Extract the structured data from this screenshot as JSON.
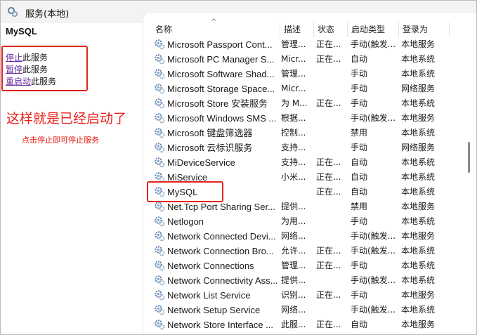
{
  "window": {
    "title": "服务(本地)",
    "icon": "gear-services-icon"
  },
  "left_panel": {
    "service_name": "MySQL",
    "actions": [
      {
        "link": "停止",
        "suffix": "此服务"
      },
      {
        "link": "暂停",
        "suffix": "此服务"
      },
      {
        "link": "重启动",
        "suffix": "此服务"
      }
    ],
    "annotation_main": "这样就是已经启动了",
    "annotation_sub": "点击停止即可停止服务"
  },
  "table": {
    "columns": [
      "名称",
      "描述",
      "状态",
      "启动类型",
      "登录为"
    ],
    "sorted_column": "名称",
    "rows": [
      {
        "name": "Microsoft Passport Cont...",
        "desc": "管理...",
        "status": "正在...",
        "startup": "手动(触发...",
        "logon": "本地服务"
      },
      {
        "name": "Microsoft PC Manager S...",
        "desc": "Micr...",
        "status": "正在...",
        "startup": "自动",
        "logon": "本地系统"
      },
      {
        "name": "Microsoft Software Shad...",
        "desc": "管理...",
        "status": "",
        "startup": "手动",
        "logon": "本地系统"
      },
      {
        "name": "Microsoft Storage Space...",
        "desc": "Micr...",
        "status": "",
        "startup": "手动",
        "logon": "网络服务"
      },
      {
        "name": "Microsoft Store 安装服务",
        "desc": "为 M...",
        "status": "正在...",
        "startup": "手动",
        "logon": "本地系统"
      },
      {
        "name": "Microsoft Windows SMS ...",
        "desc": "根据...",
        "status": "",
        "startup": "手动(触发...",
        "logon": "本地服务"
      },
      {
        "name": "Microsoft 键盘筛选器",
        "desc": "控制...",
        "status": "",
        "startup": "禁用",
        "logon": "本地系统"
      },
      {
        "name": "Microsoft 云标识服务",
        "desc": "支持...",
        "status": "",
        "startup": "手动",
        "logon": "网络服务"
      },
      {
        "name": "MiDeviceService",
        "desc": "支持...",
        "status": "正在...",
        "startup": "自动",
        "logon": "本地系统"
      },
      {
        "name": "MiService",
        "desc": "小米...",
        "status": "正在...",
        "startup": "自动",
        "logon": "本地系统"
      },
      {
        "name": "MySQL",
        "desc": "",
        "status": "正在...",
        "startup": "自动",
        "logon": "本地系统"
      },
      {
        "name": "Net.Tcp Port Sharing Ser...",
        "desc": "提供...",
        "status": "",
        "startup": "禁用",
        "logon": "本地服务"
      },
      {
        "name": "Netlogon",
        "desc": "为用...",
        "status": "",
        "startup": "手动",
        "logon": "本地系统"
      },
      {
        "name": "Network Connected Devi...",
        "desc": "网络...",
        "status": "",
        "startup": "手动(触发...",
        "logon": "本地服务"
      },
      {
        "name": "Network Connection Bro...",
        "desc": "允许...",
        "status": "正在...",
        "startup": "手动(触发...",
        "logon": "本地系统"
      },
      {
        "name": "Network Connections",
        "desc": "管理...",
        "status": "正在...",
        "startup": "手动",
        "logon": "本地系统"
      },
      {
        "name": "Network Connectivity Ass...",
        "desc": "提供...",
        "status": "",
        "startup": "手动(触发...",
        "logon": "本地系统"
      },
      {
        "name": "Network List Service",
        "desc": "识别...",
        "status": "正在...",
        "startup": "手动",
        "logon": "本地服务"
      },
      {
        "name": "Network Setup Service",
        "desc": "网络...",
        "status": "",
        "startup": "手动(触发...",
        "logon": "本地系统"
      },
      {
        "name": "Network Store Interface ...",
        "desc": "此服...",
        "status": "正在...",
        "startup": "自动",
        "logon": "本地服务"
      }
    ],
    "highlighted_row": "MySQL",
    "row_icon": "service-gear-icon"
  },
  "colors": {
    "annotation": "#e8211b",
    "link": "#6a2fa0"
  }
}
